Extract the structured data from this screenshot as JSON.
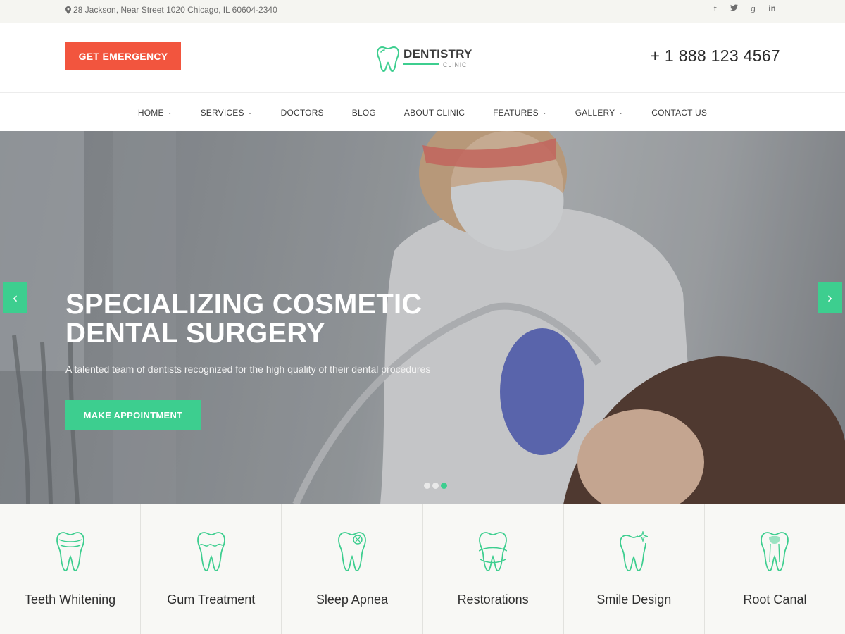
{
  "topbar": {
    "address": "28 Jackson, Near Street 1020 Chicago, IL 60604-2340",
    "social": [
      {
        "icon": "facebook-icon",
        "glyph": "f"
      },
      {
        "icon": "twitter-icon",
        "glyph": "☐"
      },
      {
        "icon": "google-plus-icon",
        "glyph": "g"
      },
      {
        "icon": "linkedin-icon",
        "glyph": "in"
      }
    ]
  },
  "header": {
    "emergency_label": "GET EMERGENCY",
    "logo_name": "DENTISTRY",
    "logo_sub": "CLINIC",
    "phone": "+ 1 888 123 4567"
  },
  "nav": {
    "items": [
      {
        "label": "HOME",
        "dropdown": true
      },
      {
        "label": "SERVICES",
        "dropdown": true
      },
      {
        "label": "DOCTORS",
        "dropdown": false
      },
      {
        "label": "BLOG",
        "dropdown": false
      },
      {
        "label": "ABOUT CLINIC",
        "dropdown": false
      },
      {
        "label": "FEATURES",
        "dropdown": true
      },
      {
        "label": "GALLERY",
        "dropdown": true
      },
      {
        "label": "CONTACT US",
        "dropdown": false
      }
    ]
  },
  "hero": {
    "title_line1": "SPECIALIZING COSMETIC",
    "title_line2": "DENTAL SURGERY",
    "description": "A talented team of dentists recognized for the high quality of their dental procedures",
    "cta_label": "MAKE APPOINTMENT",
    "prev_glyph": "‹",
    "next_glyph": "›",
    "slides_count": 3,
    "active_slide": 3
  },
  "services": [
    {
      "label": "Teeth Whitening",
      "icon": "tooth-whitening-icon"
    },
    {
      "label": "Gum Treatment",
      "icon": "tooth-gum-icon"
    },
    {
      "label": "Sleep Apnea",
      "icon": "tooth-sleep-icon"
    },
    {
      "label": "Restorations",
      "icon": "tooth-restoration-icon"
    },
    {
      "label": "Smile Design",
      "icon": "tooth-sparkle-icon"
    },
    {
      "label": "Root Canal",
      "icon": "tooth-root-canal-icon"
    }
  ],
  "colors": {
    "accent": "#3dce8f",
    "emergency": "#f2553e",
    "topbar_bg": "#f5f5f1"
  }
}
